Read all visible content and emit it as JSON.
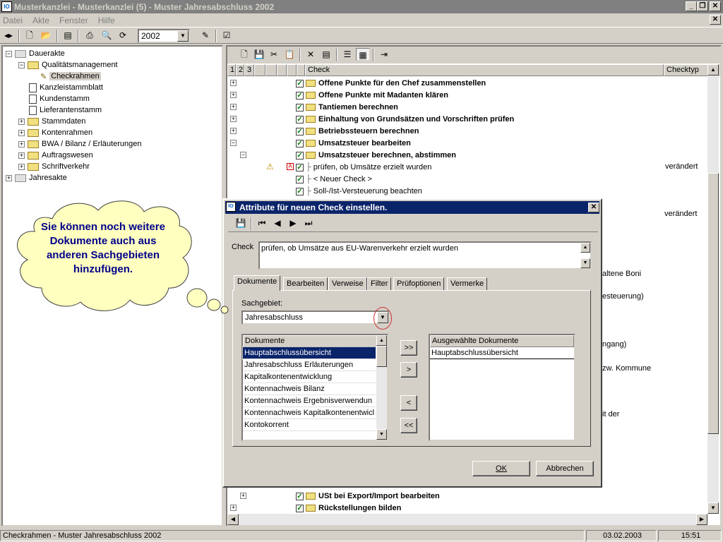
{
  "window": {
    "title": "Musterkanzlei - Musterkanzlei (5) - Muster Jahresabschluss 2002"
  },
  "menu": [
    "Datei",
    "Akte",
    "Fenster",
    "Hilfe"
  ],
  "toolbar": {
    "year": "2002"
  },
  "tree": [
    {
      "label": "Dauerakte",
      "level": 0,
      "exp": "−",
      "icon": "folder-grey"
    },
    {
      "label": "Qualitätsmanagement",
      "level": 1,
      "exp": "−",
      "icon": "folder"
    },
    {
      "label": "Checkrahmen",
      "level": 2,
      "exp": "",
      "icon": "check",
      "selected": true
    },
    {
      "label": "Kanzleistammblatt",
      "level": 1,
      "exp": "",
      "icon": "doc"
    },
    {
      "label": "Kundenstamm",
      "level": 1,
      "exp": "",
      "icon": "doc"
    },
    {
      "label": "Lieferantenstamm",
      "level": 1,
      "exp": "",
      "icon": "doc"
    },
    {
      "label": "Stammdaten",
      "level": 1,
      "exp": "+",
      "icon": "folder"
    },
    {
      "label": "Kontenrahmen",
      "level": 1,
      "exp": "+",
      "icon": "folder"
    },
    {
      "label": "BWA / Bilanz / Erläuterungen",
      "level": 1,
      "exp": "+",
      "icon": "folder"
    },
    {
      "label": "Auftragswesen",
      "level": 1,
      "exp": "+",
      "icon": "folder"
    },
    {
      "label": "Schriftverkehr",
      "level": 1,
      "exp": "+",
      "icon": "folder"
    },
    {
      "label": "Jahresakte",
      "level": 0,
      "exp": "+",
      "icon": "folder-grey"
    }
  ],
  "columns": {
    "levels": [
      "1",
      "2",
      "3"
    ],
    "check": "Check",
    "checktyp": "Checktyp"
  },
  "rows": [
    {
      "label": "Offene Punkte für den Chef zusammenstellen",
      "bold": true,
      "exp": "+"
    },
    {
      "label": "Offene Punkte mit Madanten klären",
      "bold": true,
      "exp": "+"
    },
    {
      "label": "Tantiemen berechnen",
      "bold": true,
      "exp": "+"
    },
    {
      "label": "Einhaltung von Grundsätzen und Vorschriften prüfen",
      "bold": true,
      "exp": "+"
    },
    {
      "label": "Betriebssteuern berechnen",
      "bold": true,
      "exp": "+"
    },
    {
      "label": "Umsatzsteuer bearbeiten",
      "bold": true,
      "exp": "−"
    },
    {
      "label": "Umsatzsteuer berechnen, abstimmen",
      "bold": true,
      "exp": "−",
      "sub": true
    },
    {
      "label": "prüfen, ob Umsätze erzielt wurden",
      "bold": false,
      "child": true,
      "warn": true,
      "type": "verändert"
    },
    {
      "label": "< Neuer Check >",
      "bold": false,
      "child": true
    },
    {
      "label": "Soll-/Ist-Versteuerung beachten",
      "bold": false,
      "child": true
    }
  ],
  "row_type_extra": "verändert",
  "bottom_rows": [
    {
      "label": "USt bei Export/Import bearbeiten",
      "bold": true,
      "exp": "+",
      "sub": true
    },
    {
      "label": "Rückstellungen bilden",
      "bold": true,
      "exp": "+"
    }
  ],
  "partial_texts": [
    "altene Boni",
    "esteuerung)",
    "ngang)",
    "zw. Kommune",
    "it der"
  ],
  "dialog": {
    "title": "Attribute für neuen Check einstellen.",
    "check_label": "Check",
    "check_value": "prüfen, ob Umsätze aus EU-Warenverkehr erzielt wurden",
    "tabs": [
      "Dokumente",
      "Bearbeiten",
      "Verweise",
      "Filter",
      "Prüfoptionen",
      "Vermerke"
    ],
    "sachgebiet_label": "Sachgebiet:",
    "sachgebiet_value": "Jahresabschluss",
    "doc_header": "Dokumente",
    "docs": [
      "Hauptabschlussübersicht",
      "Jahresabschluss Erläuterungen",
      "Kapitalkontenentwicklung",
      "Kontennachweis Bilanz",
      "Kontennachweis Ergebnisverwendun",
      "Kontennachweis Kapitalkontenentwicl",
      "Kontokorrent"
    ],
    "sel_header": "Ausgewählte Dokumente",
    "selected": [
      "Hauptabschlussübersicht"
    ],
    "btn_all_right": ">>",
    "btn_right": ">",
    "btn_left": "<",
    "btn_all_left": "<<",
    "ok": "OK",
    "cancel": "Abbrechen"
  },
  "callout": "Sie können noch weitere Dokumente auch aus anderen Sachgebieten hinzufügen.",
  "status": {
    "left": "Checkrahmen - Muster Jahresabschluss 2002",
    "date": "03.02.2003",
    "time": "15:51"
  }
}
